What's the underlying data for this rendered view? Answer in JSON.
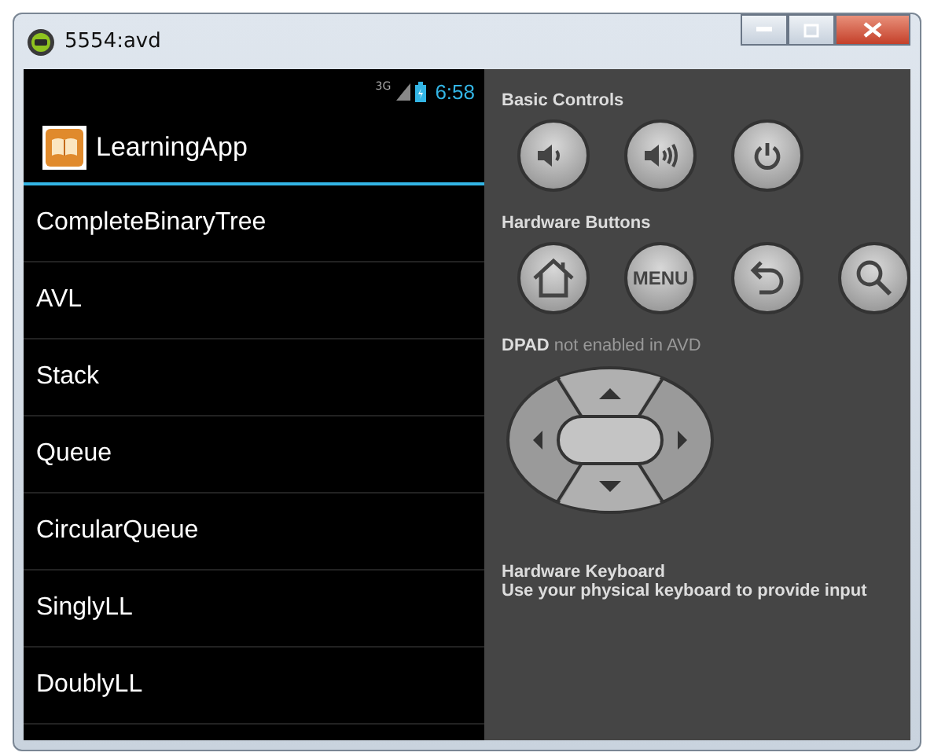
{
  "window": {
    "title": "5554:avd"
  },
  "status_bar": {
    "network": "3G",
    "time": "6:58"
  },
  "action_bar": {
    "title": "LearningApp"
  },
  "list": [
    {
      "label": "CompleteBinaryTree"
    },
    {
      "label": "AVL"
    },
    {
      "label": "Stack"
    },
    {
      "label": "Queue"
    },
    {
      "label": "CircularQueue"
    },
    {
      "label": "SinglyLL"
    },
    {
      "label": "DoublyLL"
    }
  ],
  "basic_controls": {
    "heading": "Basic Controls",
    "buttons": [
      {
        "kind": "volume-down"
      },
      {
        "kind": "volume-up"
      },
      {
        "kind": "power"
      }
    ]
  },
  "hardware_buttons": {
    "heading": "Hardware Buttons",
    "buttons": [
      {
        "kind": "home"
      },
      {
        "kind": "menu",
        "label": "MENU"
      },
      {
        "kind": "back"
      },
      {
        "kind": "search"
      }
    ]
  },
  "dpad": {
    "note": "**DPAD** not enabled in AVD"
  },
  "keyboard": {
    "heading": "Hardware Keyboard",
    "text": "Use your physical keyboard to provide input"
  }
}
